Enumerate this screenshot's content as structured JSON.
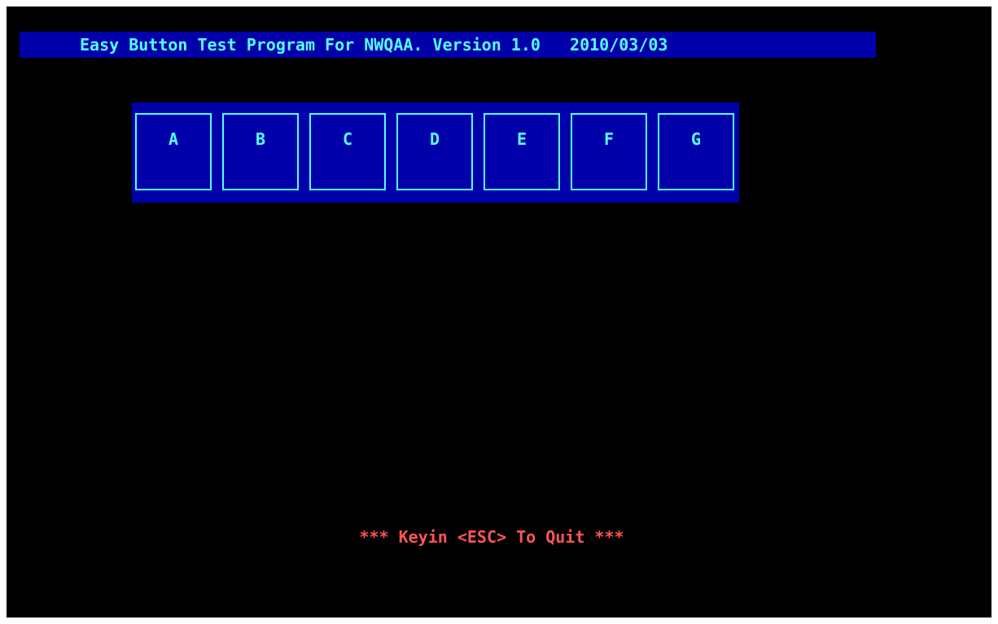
{
  "colors": {
    "background": "#000000",
    "panel": "#0000aa",
    "text_cyan": "#55ffff",
    "text_red": "#ff5555"
  },
  "header": {
    "title": "Easy Button Test Program For NWQAA. Version 1.0   2010/03/03"
  },
  "buttons": [
    {
      "label": "A"
    },
    {
      "label": "B"
    },
    {
      "label": "C"
    },
    {
      "label": "D"
    },
    {
      "label": "E"
    },
    {
      "label": "F"
    },
    {
      "label": "G"
    }
  ],
  "footer": {
    "hint": "*** Keyin <ESC> To Quit ***"
  }
}
